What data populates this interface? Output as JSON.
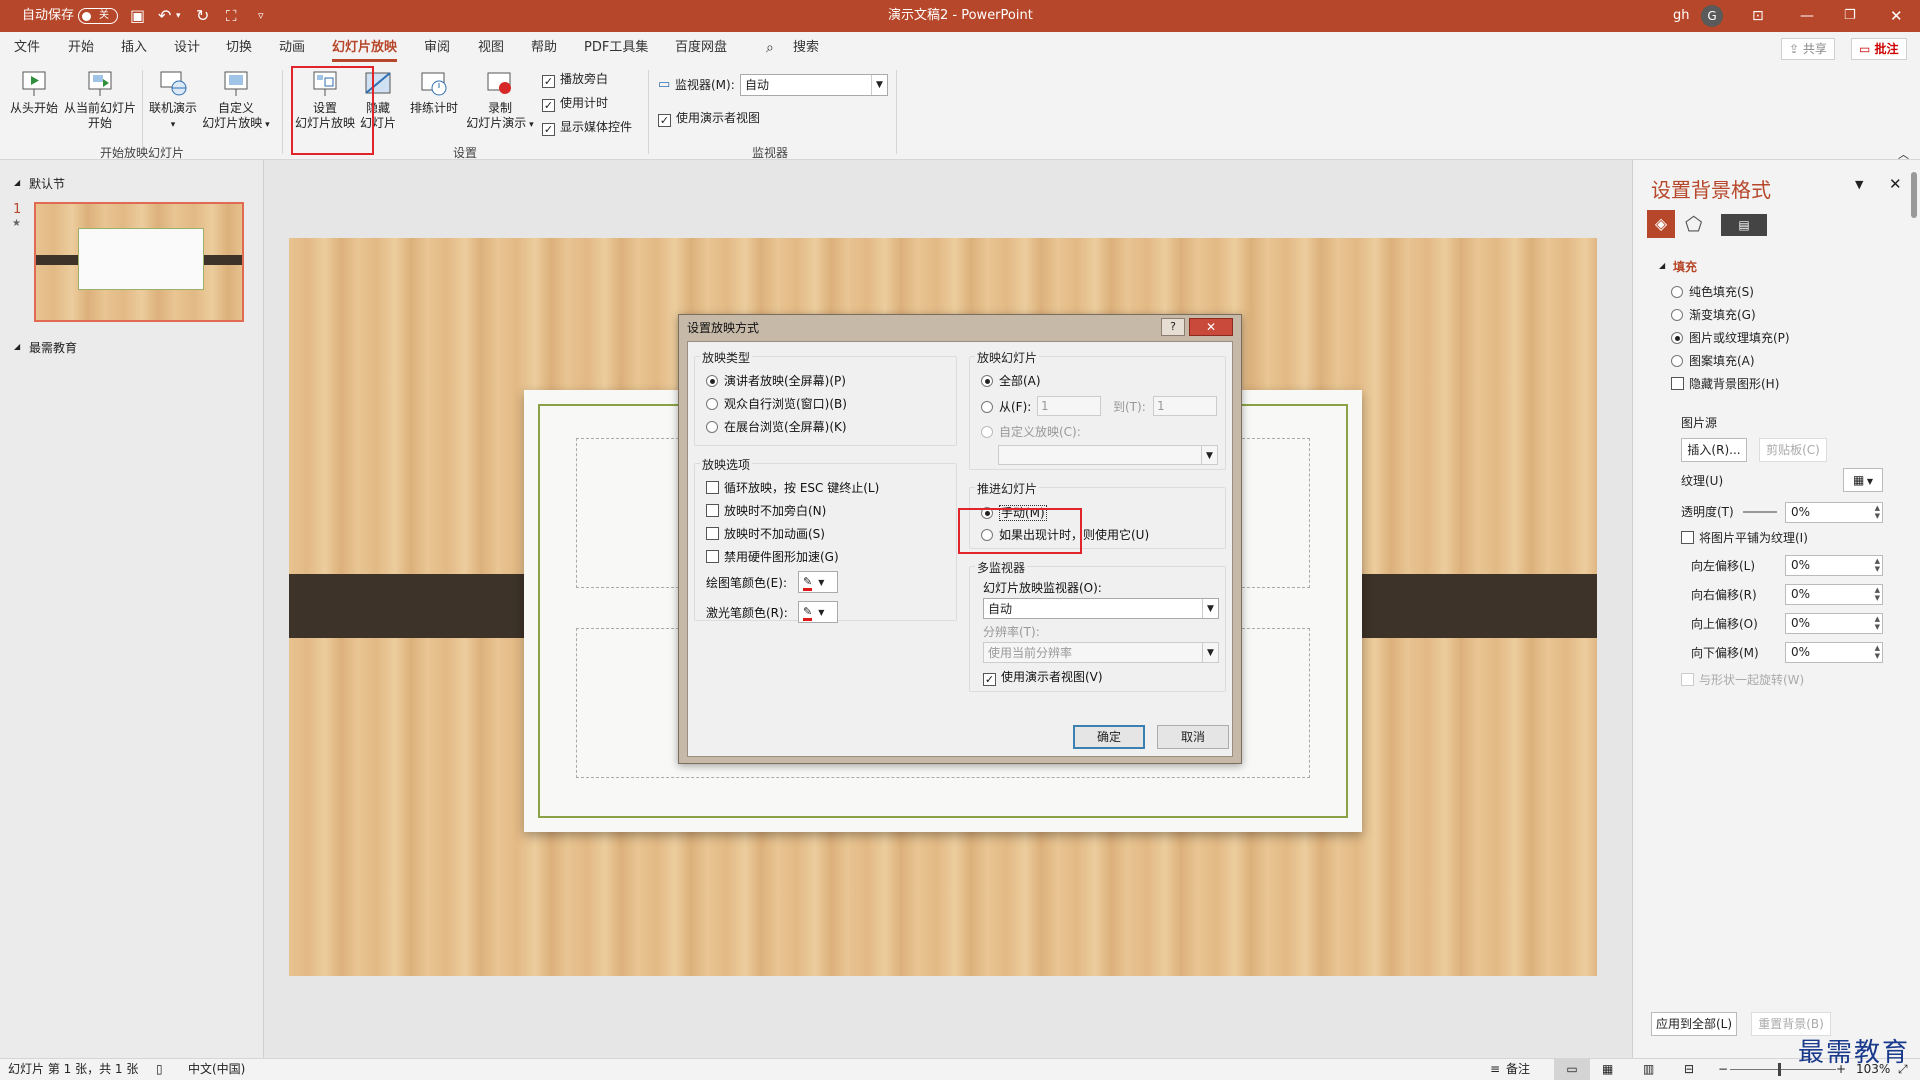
{
  "titlebar": {
    "autosave_label": "自动保存",
    "autosave_state": "关",
    "doc_title": "演示文稿2  -  PowerPoint",
    "user_initials": "gh",
    "avatar_letter": "G",
    "accent": "#b7472a"
  },
  "menu": {
    "items": [
      "文件",
      "开始",
      "插入",
      "设计",
      "切换",
      "动画",
      "幻灯片放映",
      "审阅",
      "视图",
      "帮助",
      "PDF工具集",
      "百度网盘"
    ],
    "active": "幻灯片放映",
    "search_label": "搜索",
    "share_label": "共享",
    "comment_label": "批注"
  },
  "ribbon": {
    "from_start_label": "从头开始",
    "from_current_l1": "从当前幻灯片",
    "from_current_l2": "开始",
    "online_l1": "联机演示",
    "custom_l1": "自定义",
    "custom_l2": "幻灯片放映",
    "setup_l1": "设置",
    "setup_l2": "幻灯片放映",
    "hide_l1": "隐藏",
    "hide_l2": "幻灯片",
    "rehearse_label": "排练计时",
    "record_l1": "录制",
    "record_l2": "幻灯片演示",
    "play_narration": "播放旁白",
    "use_timings": "使用计时",
    "show_media": "显示媒体控件",
    "monitor_label": "监视器(M):",
    "monitor_value": "自动",
    "presenter_view": "使用演示者视图",
    "group_start": "开始放映幻灯片",
    "group_setup": "设置",
    "group_monitor": "监视器"
  },
  "left_pane": {
    "section1": "默认节",
    "slide_number": "1",
    "slide_star": "★",
    "section2": "最需教育"
  },
  "dialog": {
    "title": "设置放映方式",
    "help": "?",
    "show_type_title": "放映类型",
    "show_type_options": [
      "演讲者放映(全屏幕)(P)",
      "观众自行浏览(窗口)(B)",
      "在展台浏览(全屏幕)(K)"
    ],
    "show_options_title": "放映选项",
    "show_options": [
      "循环放映，按 ESC 键终止(L)",
      "放映时不加旁白(N)",
      "放映时不加动画(S)",
      "禁用硬件图形加速(G)"
    ],
    "pen_color_label": "绘图笔颜色(E):",
    "laser_color_label": "激光笔颜色(R):",
    "slides_title": "放映幻灯片",
    "slides_all": "全部(A)",
    "slides_from": "从(F):",
    "slides_from_value": "1",
    "slides_to": "到(T):",
    "slides_to_value": "1",
    "slides_custom": "自定义放映(C):",
    "advance_title": "推进幻灯片",
    "advance_manual": "手动(M)",
    "advance_timings": "如果出现计时，则使用它(U)",
    "multi_title": "多监视器",
    "monitor_label": "幻灯片放映监视器(O):",
    "monitor_value": "自动",
    "resolution_label": "分辨率(T):",
    "resolution_value": "使用当前分辨率",
    "presenter_view": "使用演示者视图(V)",
    "ok": "确定",
    "cancel": "取消"
  },
  "right_pane": {
    "title": "设置背景格式",
    "fill_section": "填充",
    "fill_options": [
      "纯色填充(S)",
      "渐变填充(G)",
      "图片或纹理填充(P)",
      "图案填充(A)"
    ],
    "hide_bg_graphics": "隐藏背景图形(H)",
    "picture_source": "图片源",
    "insert_btn": "插入(R)...",
    "clipboard_btn": "剪贴板(C)",
    "texture_label": "纹理(U)",
    "transparency_label": "透明度(T)",
    "transparency_value": "0%",
    "tile_label": "将图片平铺为纹理(I)",
    "offset_left_label": "向左偏移(L)",
    "offset_left_value": "0%",
    "offset_right_label": "向右偏移(R)",
    "offset_right_value": "0%",
    "offset_top_label": "向上偏移(O)",
    "offset_top_value": "0%",
    "offset_bottom_label": "向下偏移(M)",
    "offset_bottom_value": "0%",
    "rotate_with_shape": "与形状一起旋转(W)",
    "apply_all_btn": "应用到全部(L)",
    "reset_btn": "重置背景(B)"
  },
  "statusbar": {
    "slide_info": "幻灯片 第 1 张，共 1 张",
    "language": "中文(中国)",
    "notes": "备注",
    "zoom": "103%"
  },
  "watermark": "最需教育"
}
